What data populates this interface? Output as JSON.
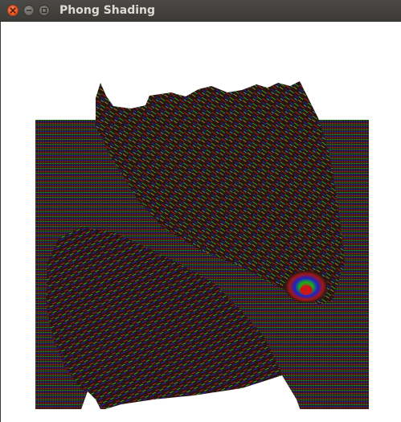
{
  "window": {
    "title": "Phong Shading",
    "controls": [
      {
        "name": "close",
        "icon": "close-icon",
        "color": "#e9541f"
      },
      {
        "name": "minimize",
        "icon": "minimize-icon",
        "color": "#76756f"
      },
      {
        "name": "maximize",
        "icon": "maximize-icon",
        "color": "#76756f"
      }
    ]
  },
  "render": {
    "description_colors": {
      "background": "#ffffff",
      "surface_base": "#2e1712",
      "stripe_red": "#c01e1e",
      "stripe_green": "#1fb51f",
      "stripe_blue": "#2323c8"
    }
  }
}
